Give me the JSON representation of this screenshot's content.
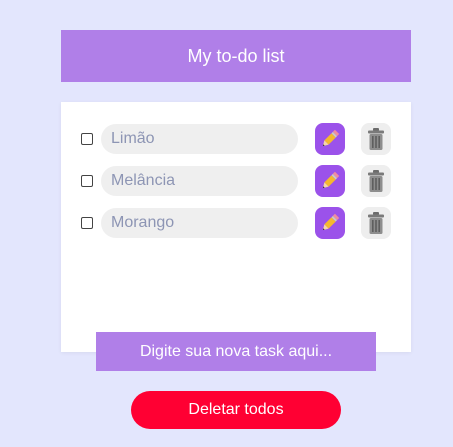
{
  "header": {
    "title": "My to-do list"
  },
  "tasks": [
    {
      "text": "Limão",
      "checked": false
    },
    {
      "text": "Melância",
      "checked": false
    },
    {
      "text": "Morango",
      "checked": false
    }
  ],
  "new_task": {
    "placeholder": "Digite sua nova task aqui..."
  },
  "delete_all": {
    "label": "Deletar todos"
  },
  "icons": {
    "edit": "pencil-icon",
    "delete": "trash-icon"
  },
  "colors": {
    "background": "#e3e6fd",
    "header": "#b07fe8",
    "edit_button": "#9b52ea",
    "delete_all": "#ff0033"
  }
}
